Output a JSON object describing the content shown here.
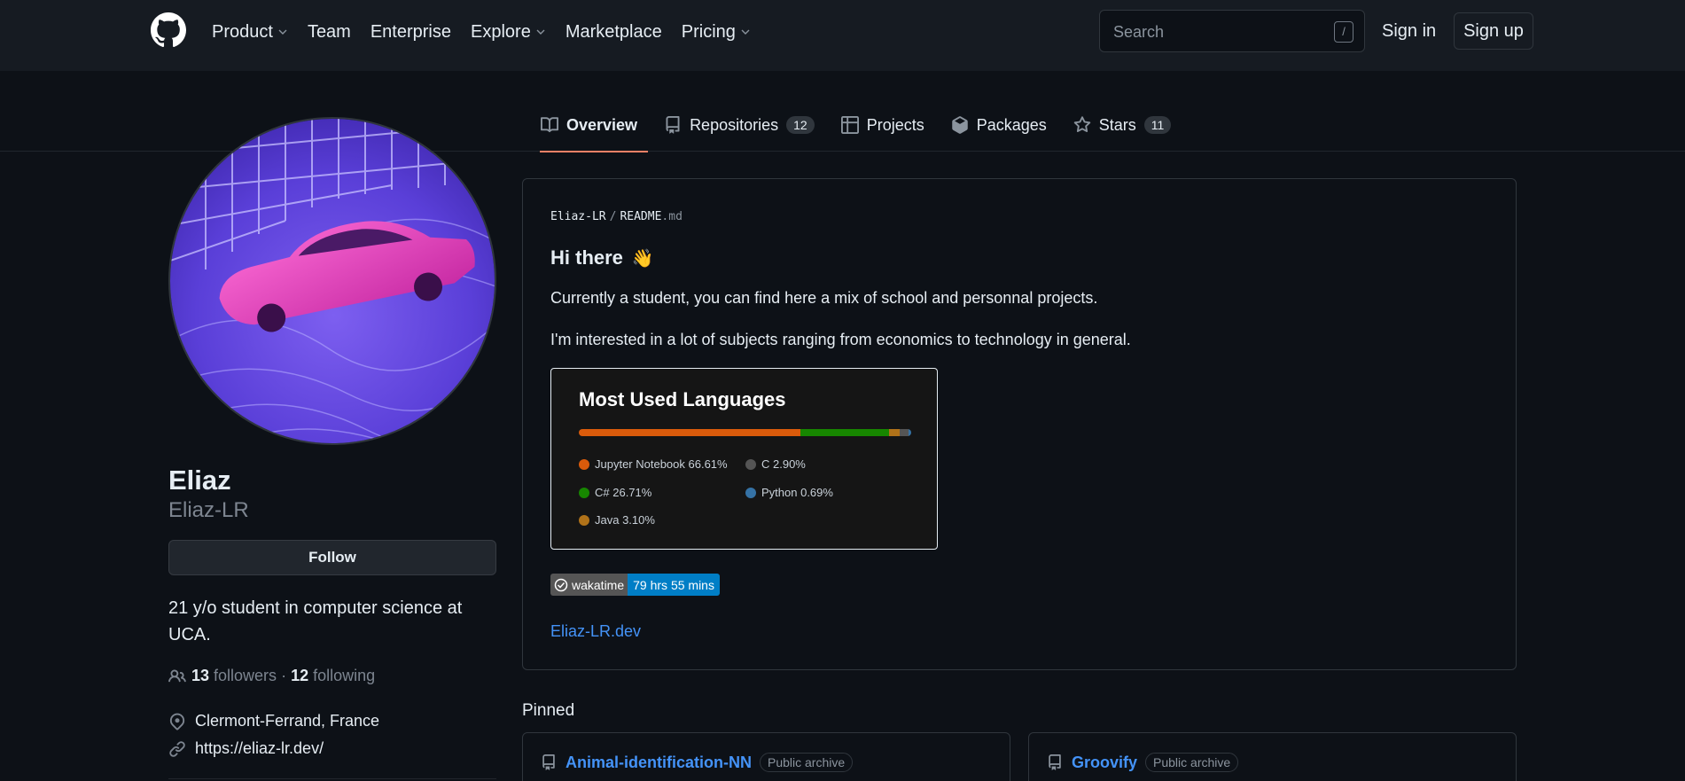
{
  "header": {
    "nav": [
      {
        "label": "Product",
        "dropdown": true
      },
      {
        "label": "Team",
        "dropdown": false
      },
      {
        "label": "Enterprise",
        "dropdown": false
      },
      {
        "label": "Explore",
        "dropdown": true
      },
      {
        "label": "Marketplace",
        "dropdown": false
      },
      {
        "label": "Pricing",
        "dropdown": true
      }
    ],
    "search_placeholder": "Search",
    "search_shortcut": "/",
    "sign_in": "Sign in",
    "sign_up": "Sign up"
  },
  "tabs": [
    {
      "label": "Overview",
      "icon": "book-icon",
      "active": true,
      "count": ""
    },
    {
      "label": "Repositories",
      "icon": "repo-icon",
      "active": false,
      "count": "12"
    },
    {
      "label": "Projects",
      "icon": "table-icon",
      "active": false,
      "count": ""
    },
    {
      "label": "Packages",
      "icon": "package-icon",
      "active": false,
      "count": ""
    },
    {
      "label": "Stars",
      "icon": "star-icon",
      "active": false,
      "count": "11"
    }
  ],
  "profile": {
    "name": "Eliaz",
    "login": "Eliaz-LR",
    "follow_label": "Follow",
    "bio": "21 y/o student in computer science at UCA.",
    "followers_count": "13",
    "followers_label": "followers",
    "separator": "·",
    "following_count": "12",
    "following_label": "following",
    "location": "Clermont-Ferrand, France",
    "website": "https://eliaz-lr.dev/"
  },
  "readme": {
    "owner": "Eliaz-LR",
    "path_sep": "/",
    "file_base": "README",
    "file_ext": ".md",
    "heading": "Hi there",
    "heading_emoji": "👋",
    "paragraph1": "Currently a student, you can find here a mix of school and personnal projects.",
    "paragraph2": "I'm interested in a lot of subjects ranging from economics to technology in general.",
    "languages_card": {
      "title": "Most Used Languages",
      "items": [
        {
          "label": "Jupyter Notebook 66.61%",
          "color": "#DA5B0B",
          "percent": 66.61
        },
        {
          "label": "C# 26.71%",
          "color": "#178600",
          "percent": 26.71
        },
        {
          "label": "Java 3.10%",
          "color": "#b07219",
          "percent": 3.1
        },
        {
          "label": "C 2.90%",
          "color": "#555555",
          "percent": 2.9
        },
        {
          "label": "Python 0.69%",
          "color": "#3572A5",
          "percent": 0.69
        }
      ]
    },
    "wakatime_label": "wakatime",
    "wakatime_value": "79 hrs 55 mins",
    "link": "Eliaz-LR.dev"
  },
  "pinned": {
    "title": "Pinned",
    "items": [
      {
        "name": "Animal-identification-NN",
        "badge": "Public archive"
      },
      {
        "name": "Groovify",
        "badge": "Public archive"
      }
    ]
  },
  "colors": {
    "background": "#0d1117",
    "header": "#161b22",
    "accent_tab": "#f78166",
    "link": "#4493f8",
    "wakatime_blue": "#007ec6"
  }
}
